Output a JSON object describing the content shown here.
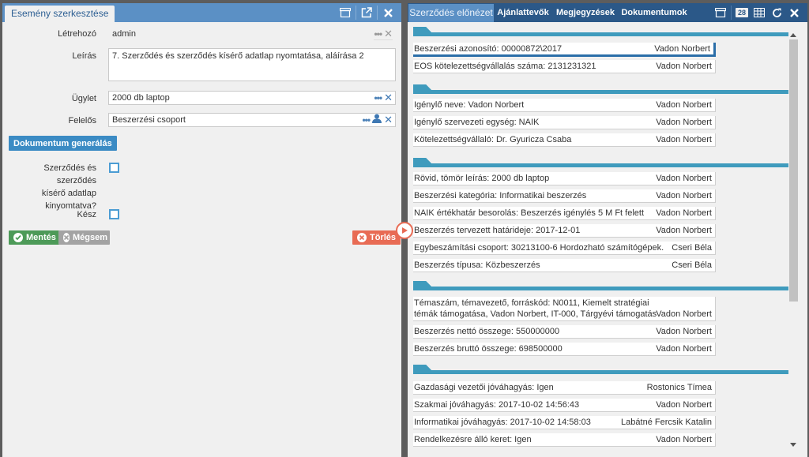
{
  "left": {
    "tab_title": "Esemény szerkesztése",
    "fields": {
      "letrehozo_label": "Létrehozó",
      "letrehozo_value": "admin",
      "leiras_label": "Leírás",
      "leiras_value": "7. Szerződés és szerződés kísérő adatlap nyomtatása, aláírása 2",
      "ugylet_label": "Ügylet",
      "ugylet_value": "2000 db laptop",
      "felelos_label": "Felelős",
      "felelos_value": "Beszerzési csoport"
    },
    "generate_button": "Dokumentum generálás",
    "printed_label_line1": "Szerződés és szerződés",
    "printed_label_line2": "kísérő adatlap",
    "printed_label_line3": "kinyomtatva?",
    "done_label": "Kész",
    "save_button": "Mentés",
    "cancel_button": "Mégsem",
    "delete_button": "Törlés"
  },
  "right": {
    "tabs": [
      {
        "label": "Szerződés előnézet"
      },
      {
        "label": "Ajánlattevők"
      },
      {
        "label": "Megjegyzések"
      },
      {
        "label": "Dokumentumok"
      }
    ],
    "count_badge": "28",
    "rows": [
      {
        "text": "Beszerzési azonosító: 00000872\\2017",
        "user": "Vadon Norbert"
      },
      {
        "text": "EOS kötelezettségvállalás száma: 2131231321",
        "user": "Vadon Norbert"
      },
      {
        "text": "Igénylő neve: Vadon Norbert",
        "user": "Vadon Norbert"
      },
      {
        "text": "Igénylő szervezeti egység: NAIK",
        "user": "Vadon Norbert"
      },
      {
        "text": "Kötelezettségvállaló: Dr. Gyuricza Csaba",
        "user": "Vadon Norbert"
      },
      {
        "text": "Rövid, tömör leírás: 2000 db laptop",
        "user": "Vadon Norbert"
      },
      {
        "text": "Beszerzési kategória: Informatikai beszerzés",
        "user": "Vadon Norbert"
      },
      {
        "text": "NAIK értékhatár besorolás: Beszerzés igénylés 5 M Ft felett",
        "user": "Vadon Norbert"
      },
      {
        "text": "Beszerzés tervezett határideje: 2017-12-01",
        "user": "Vadon Norbert"
      },
      {
        "text": "Egybeszámítási csoport: 30213100-6 Hordozható számítógépek.",
        "user": "Cseri Béla"
      },
      {
        "text": "Beszerzés típusa: Közbeszerzés",
        "user": "Cseri Béla"
      },
      {
        "text": "Témaszám, témavezető, forráskód: N0011, Kiemelt stratégiai témák támogatása, Vadon Norbert, IT-000, Tárgyévi támogatás",
        "user": "Vadon Norbert"
      },
      {
        "text": "Beszerzés nettó összege: 550000000",
        "user": "Vadon Norbert"
      },
      {
        "text": "Beszerzés bruttó összege: 698500000",
        "user": "Vadon Norbert"
      },
      {
        "text": "Gazdasági vezetői jóváhagyás: Igen",
        "user": "Rostonics Tímea"
      },
      {
        "text": "Szakmai jóváhagyás: 2017-10-02 14:56:43",
        "user": "Vadon Norbert"
      },
      {
        "text": "Informatikai jóváhagyás: 2017-10-02 14:58:03",
        "user": "Labátné Fercsik Katalin"
      },
      {
        "text": "Rendelkezésre álló keret: Igen",
        "user": "Vadon Norbert"
      }
    ]
  },
  "colors": {
    "header_blue": "#5b90c5",
    "dark_blue": "#2b5888",
    "section_teal": "#3f9bbd",
    "save_green": "#4d9a58",
    "delete_red": "#e86b54"
  }
}
